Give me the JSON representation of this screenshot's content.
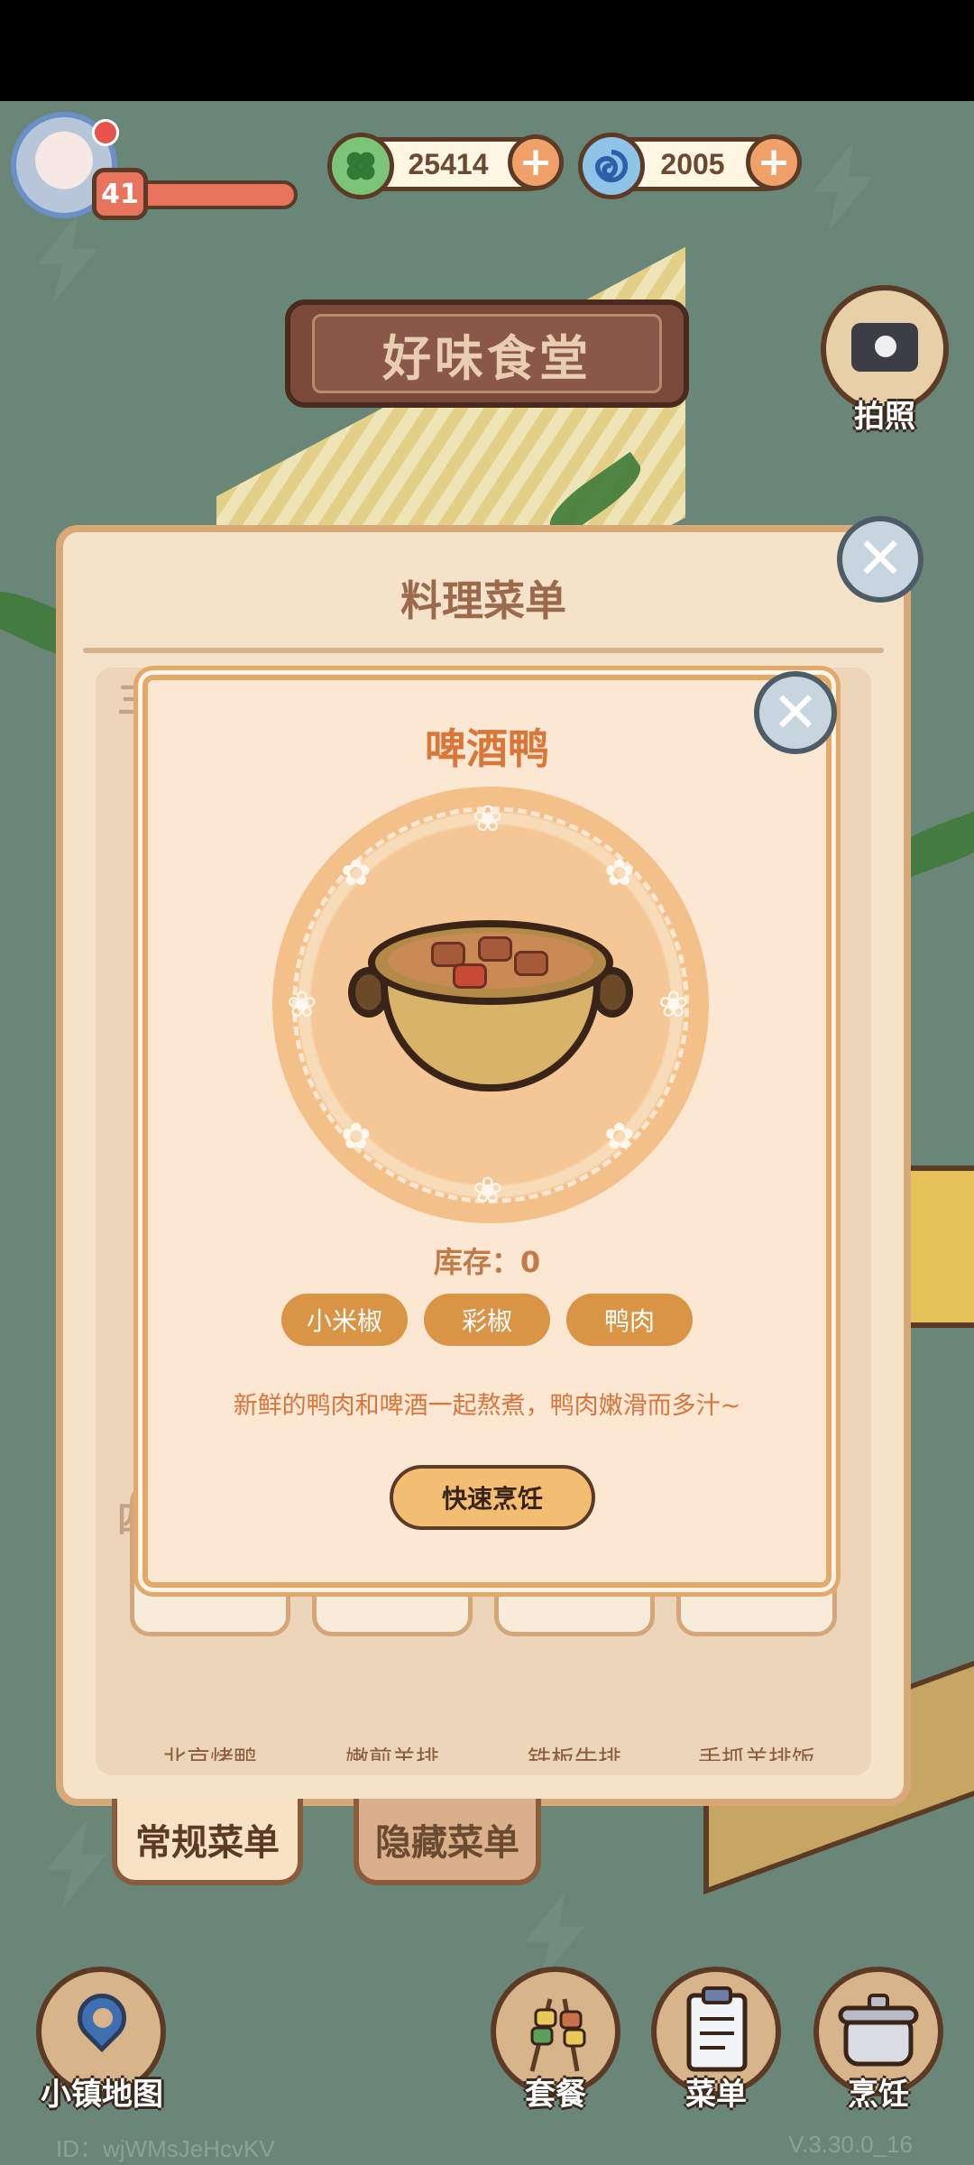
{
  "hud": {
    "level": "41",
    "clover_coins": "25414",
    "swirl_gems": "2005",
    "plus_symbol": "+"
  },
  "restaurant": {
    "sign": "好味食堂"
  },
  "camera": {
    "label": "拍照",
    "icon": "camera-icon"
  },
  "menu_panel": {
    "title": "料理菜单",
    "close": "✕",
    "section_marks": [
      "三",
      "四"
    ],
    "dishes": [
      {
        "name": "北京烤鸭",
        "food_color": "#d99a48"
      },
      {
        "name": "嫩煎羊排",
        "food_color": "#a8684a"
      },
      {
        "name": "铁板牛排",
        "food_color": "#6a3a24"
      },
      {
        "name": "手抓羊排饭",
        "food_color": "#d9a060"
      }
    ],
    "tabs": [
      {
        "label": "常规菜单",
        "active": true
      },
      {
        "label": "隐藏菜单",
        "active": false
      }
    ]
  },
  "dish_detail": {
    "title": "啤酒鸭",
    "close": "✕",
    "stock": "库存：0",
    "ingredients": [
      "小米椒",
      "彩椒",
      "鸭肉"
    ],
    "description": "新鲜的鸭肉和啤酒一起熬煮，鸭肉嫩滑而多汁~",
    "cook_button": "快速烹饪"
  },
  "bottom_nav": [
    {
      "label": "小镇地图",
      "icon": "map-pin-icon"
    },
    {
      "label": "套餐",
      "icon": "skewers-icon"
    },
    {
      "label": "菜单",
      "icon": "clipboard-icon"
    },
    {
      "label": "烹饪",
      "icon": "cooking-pot-icon"
    }
  ],
  "footer": {
    "id": "ID：wjWMsJeHcvKV",
    "version": "V.3.30.0_16"
  },
  "colors": {
    "accent_orange": "#d9763a",
    "ingredient_pill": "#d99446",
    "panel_border": "#e3a96b",
    "outline_brown": "#5b3b25"
  }
}
